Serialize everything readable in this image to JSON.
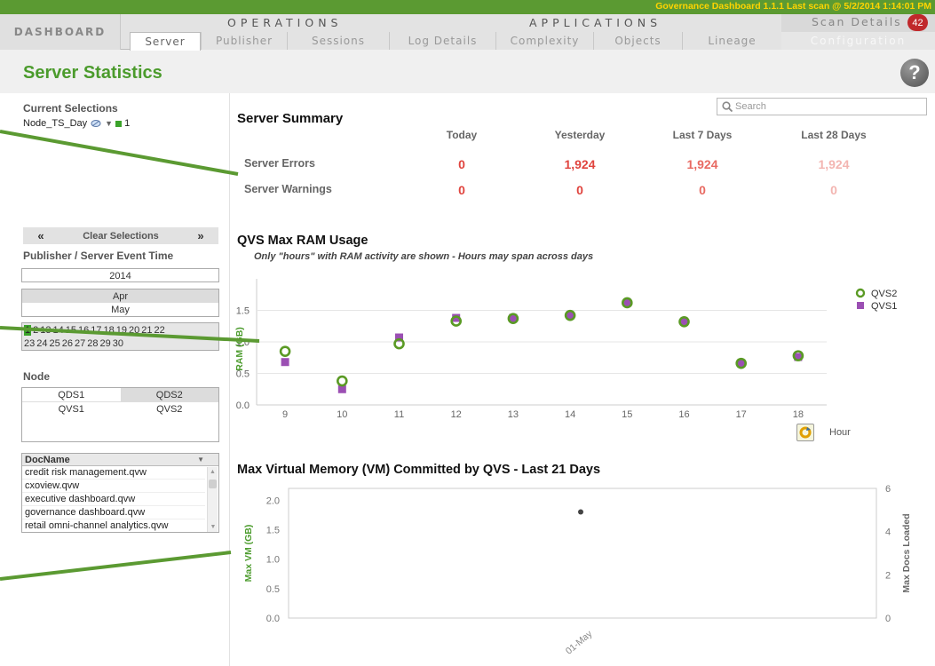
{
  "header": {
    "title_bar": "Governance Dashboard 1.1.1     Last scan @ 5/2/2014 1:14:01 PM",
    "dashboard_label": "DASHBOARD",
    "operations_label": "OPERATIONS",
    "applications_label": "APPLICATIONS",
    "scan_details_label": "Scan Details",
    "scan_badge": "42",
    "configuration_label": "Configuration",
    "tabs": [
      {
        "label": "Server",
        "active": true
      },
      {
        "label": "Publisher",
        "active": false
      },
      {
        "label": "Sessions",
        "active": false
      },
      {
        "label": "Log Details",
        "active": false
      },
      {
        "label": "Complexity",
        "active": false
      },
      {
        "label": "Objects",
        "active": false
      },
      {
        "label": "Lineage",
        "active": false
      }
    ]
  },
  "page": {
    "title": "Server Statistics"
  },
  "sidebar": {
    "current_selections_title": "Current Selections",
    "selection_field": "Node_TS_Day",
    "selection_value": "1",
    "clear_selections_label": "Clear Selections",
    "prev_label": "«",
    "next_label": "»",
    "publisher_title": "Publisher / Server Event Time",
    "year": "2014",
    "months": [
      "Apr",
      "May"
    ],
    "days_row1": [
      "1",
      "2",
      "13",
      "14",
      "15",
      "16",
      "17",
      "18",
      "19",
      "20",
      "21",
      "22"
    ],
    "days_row2": [
      "23",
      "24",
      "25",
      "26",
      "27",
      "28",
      "29",
      "30"
    ],
    "node_title": "Node",
    "nodes": [
      [
        "QDS1",
        "QDS2"
      ],
      [
        "QVS1",
        "QVS2"
      ]
    ],
    "docname_header": "DocName",
    "docs": [
      "credit risk management.qvw",
      "cxoview.qvw",
      "executive dashboard.qvw",
      "governance dashboard.qvw",
      "retail omni-channel analytics.qvw"
    ]
  },
  "summary": {
    "search_placeholder": "Search",
    "title": "Server Summary",
    "columns": [
      "Today",
      "Yesterday",
      "Last 7 Days",
      "Last 28 Days"
    ],
    "rows": [
      {
        "label": "Server Errors",
        "values": [
          "0",
          "1,924",
          "1,924",
          "1,924"
        ]
      },
      {
        "label": "Server Warnings",
        "values": [
          "0",
          "0",
          "0",
          "0"
        ]
      }
    ]
  },
  "ram_chart_text": {
    "title": "QVS Max RAM Usage",
    "subtitle": "Only \"hours\" with RAM activity are shown - Hours may span across days",
    "hour_button": "Hour"
  },
  "vm_chart_text": {
    "title": "Max Virtual Memory (VM) Committed by QVS - Last 21 Days"
  },
  "colors": {
    "brand_green": "#4b9b2c",
    "error_red": "#e0443e",
    "qvs1_purple": "#9b4fb3",
    "qvs2_green": "#5a9a24"
  },
  "chart_data": [
    {
      "type": "scatter",
      "title": "QVS Max RAM Usage",
      "xlabel": "",
      "ylabel": "RAM (GB)",
      "categories": [
        "9",
        "10",
        "11",
        "12",
        "13",
        "14",
        "15",
        "16",
        "17",
        "18"
      ],
      "ylim": [
        0,
        2
      ],
      "yticks": [
        "0.0",
        "0.5",
        "1.0",
        "1.5"
      ],
      "series": [
        {
          "name": "QVS2",
          "marker": "ring",
          "values": [
            0.85,
            0.38,
            0.97,
            1.33,
            1.37,
            1.42,
            1.62,
            1.32,
            0.66,
            0.78
          ]
        },
        {
          "name": "QVS1",
          "marker": "square",
          "values": [
            0.68,
            0.25,
            1.07,
            1.38,
            1.38,
            1.42,
            1.62,
            1.32,
            0.66,
            0.76
          ]
        }
      ],
      "legend": "top-right"
    },
    {
      "type": "scatter",
      "title": "Max Virtual Memory (VM) Committed by QVS - Last 21 Days",
      "ylabel": "Max VM (GB)",
      "y2label": "Max Docs Loaded",
      "categories": [
        "01-May"
      ],
      "ylim": [
        0,
        2.2
      ],
      "yticks": [
        "0.0",
        "0.5",
        "1.0",
        "1.5",
        "2.0"
      ],
      "y2lim": [
        0,
        6
      ],
      "y2ticks": [
        "0",
        "2",
        "4",
        "6"
      ],
      "series": [
        {
          "name": "",
          "values": [
            1.8
          ]
        }
      ]
    }
  ]
}
